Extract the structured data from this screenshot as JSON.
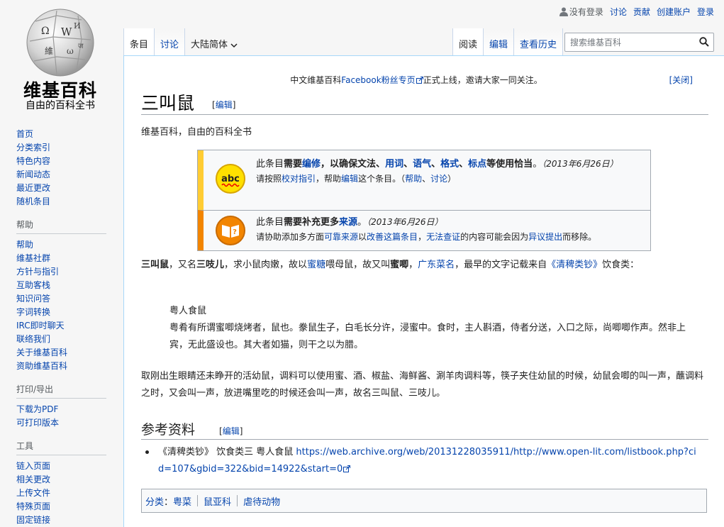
{
  "logo": {
    "name": "维基百科",
    "tagline": "自由的百科全书"
  },
  "personal": {
    "not_logged_in": "没有登录",
    "talk": "讨论",
    "contributions": "贡献",
    "create_account": "创建账户",
    "login": "登录"
  },
  "tabs_left": {
    "article": "条目",
    "talk": "讨论",
    "variant": "大陆简体"
  },
  "tabs_right": {
    "read": "阅读",
    "edit": "编辑",
    "history": "查看历史"
  },
  "search": {
    "placeholder": "搜索维基百科"
  },
  "sidebar": {
    "nav": [
      "首页",
      "分类索引",
      "特色内容",
      "新闻动态",
      "最近更改",
      "随机条目"
    ],
    "help_heading": "帮助",
    "help": [
      "帮助",
      "维基社群",
      "方针与指引",
      "互助客栈",
      "知识问答",
      "字词转换",
      "IRC即时聊天",
      "联络我们",
      "关于维基百科",
      "资助维基百科"
    ],
    "print_heading": "打印/导出",
    "print": [
      "下载为PDF",
      "可打印版本"
    ],
    "tools_heading": "工具",
    "tools": [
      "链入页面",
      "相关更改",
      "上传文件",
      "特殊页面",
      "固定链接"
    ]
  },
  "sitenotice": {
    "prefix": "中文维基百科",
    "link": "Facebook粉丝专页",
    "suffix": "正式上线，邀请大家一同关注。",
    "close": "[关闭]"
  },
  "article": {
    "title": "三叫鼠",
    "edit": "编辑",
    "tagline": "维基百科，自由的百科全书",
    "ambox": {
      "style": {
        "p1": "此条目",
        "b1": "需要",
        "l1": "编修",
        "b2": "，以确保文法、",
        "l2": "用词",
        "b3": "、",
        "l3": "语气",
        "b4": "、",
        "l4": "格式",
        "b5": "、",
        "l5": "标点",
        "b6": "等使用恰当",
        "p2": "。",
        "date": "（2013年6月26日）",
        "s1": "请按照",
        "sl1": "校对指引",
        "s2": "，帮助",
        "sl2": "编辑",
        "s3": "这个条目。（",
        "sl3": "帮助",
        "s4": "、",
        "sl4": "讨论",
        "s5": "）"
      },
      "content": {
        "p1": "此条目",
        "b1": "需要补充更多",
        "l1": "来源",
        "p2": "。",
        "date": "（2013年6月26日）",
        "s1": "请协助添加多方面",
        "sl1": "可靠来源",
        "s2": "以",
        "sl2": "改善这篇条目",
        "s3": "，",
        "sl3": "无法查证",
        "s4": "的内容可能会因为",
        "sl4": "异议提出",
        "s5": "而移除。"
      }
    },
    "p1": {
      "b1": "三叫鼠",
      "t1": "，又名",
      "b2": "三吱儿",
      "t2": "，求小鼠肉嫩，故以",
      "l1": "蜜糖",
      "t3": "喂母鼠，故又叫",
      "b3": "蜜唧",
      "t4": "，",
      "l2": "广东菜名",
      "t5": "，最早的文字记载来自",
      "l3": "《清稗类钞》",
      "t6": "饮食类："
    },
    "quote": {
      "title": "粤人食鼠",
      "body": "粤肴有所谓蜜唧烧烤者，鼠也。豢鼠生子，白毛长分许，浸蜜中。食时，主人斟酒，侍者分送，入口之际，尚唧唧作声。然非上宾，无此盛设也。其大者如猫，则干之以为腊。"
    },
    "p2": "取刚出生眼睛还未睁开的活幼鼠，调料可以使用蜜、酒、椒盐、海鲜酱、涮羊肉调料等，筷子夹住幼鼠的时候，幼鼠会唧的叫一声，蘸调料之时，又会叫一声，放进嘴里吃的时候还会叫一声，故名三叫鼠、三吱儿。",
    "refs_heading": "参考资料",
    "refs_edit": "编辑",
    "ref1": {
      "text": "《清稗类钞》 饮食类三 粤人食鼠 ",
      "url": "https://web.archive.org/web/20131228035911/http://www.open-lit.com/listbook.php?cid=107&gbid=322&bid=14922&start=0"
    },
    "categories": {
      "label": "分类",
      "items": [
        "粤菜",
        "鼠亚科",
        "虐待动物"
      ]
    }
  },
  "colors": {
    "link": "#0645ad",
    "style_bar": "#fc3",
    "content_bar": "#f28500"
  }
}
